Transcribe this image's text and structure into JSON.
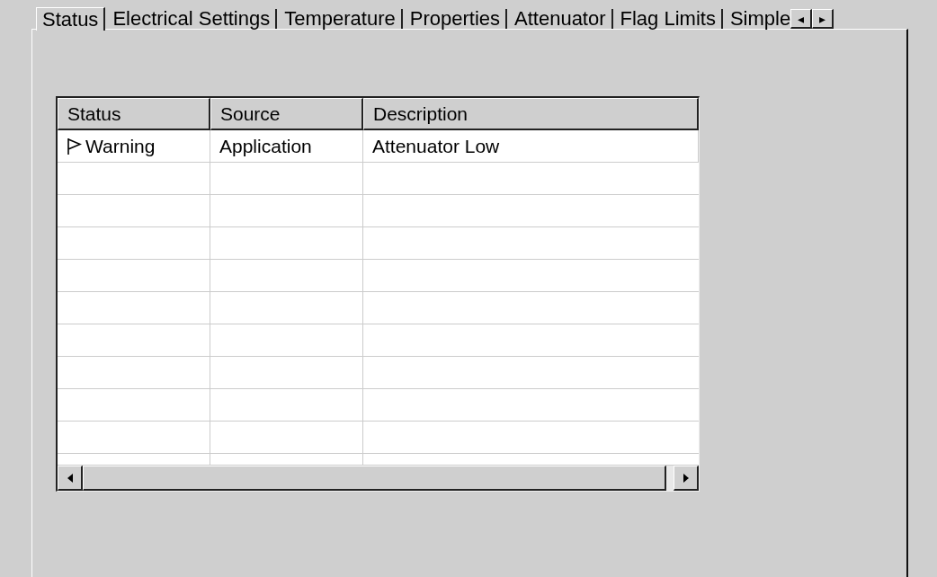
{
  "tabs": [
    {
      "label": "Status",
      "selected": true
    },
    {
      "label": "Electrical Settings",
      "selected": false
    },
    {
      "label": "Temperature",
      "selected": false
    },
    {
      "label": "Properties",
      "selected": false
    },
    {
      "label": "Attenuator",
      "selected": false
    },
    {
      "label": "Flag Limits",
      "selected": false
    },
    {
      "label": "Simple",
      "selected": false
    }
  ],
  "tab_scroll": {
    "left": "◂",
    "right": "▸"
  },
  "table": {
    "columns": [
      "Status",
      "Source",
      "Description"
    ],
    "rows": [
      {
        "status": "Warning",
        "kind": "warning",
        "source": "Application",
        "description": "Attenuator Low"
      }
    ]
  }
}
